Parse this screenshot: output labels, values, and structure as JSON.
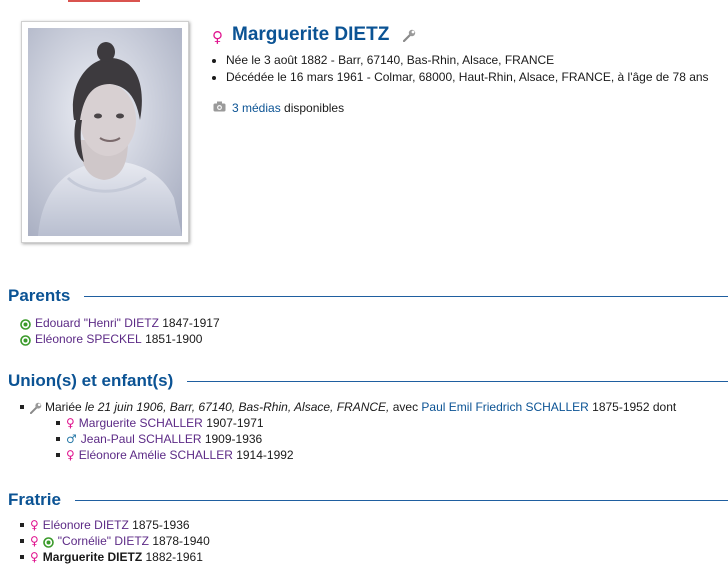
{
  "person": {
    "name": "Marguerite DIETZ",
    "birth": "Née le 3 août 1882 - Barr, 67140, Bas-Rhin, Alsace, FRANCE",
    "death": "Décédée le 16 mars 1961 - Colmar, 68000, Haut-Rhin, Alsace, FRANCE, à l'âge de 78 ans",
    "media_link": "3 médias",
    "media_suffix": " disponibles"
  },
  "parents": {
    "title": "Parents",
    "items": [
      {
        "name": "Edouard \"Henri\" DIETZ",
        "dates": " 1847-1917"
      },
      {
        "name": "Eléonore SPECKEL",
        "dates": " 1851-1900"
      }
    ]
  },
  "unions": {
    "title": "Union(s) et enfant(s)",
    "married_prefix": "Mariée ",
    "married_details": "le 21 juin 1906, Barr, 67140, Bas-Rhin, Alsace, FRANCE,",
    "with_text": " avec ",
    "spouse": "Paul Emil Friedrich SCHALLER",
    "spouse_dates": " 1875-1952 dont",
    "children": [
      {
        "name": "Marguerite SCHALLER",
        "dates": " 1907-1971",
        "sex": "F"
      },
      {
        "name": "Jean-Paul SCHALLER",
        "dates": " 1909-1936",
        "sex": "M"
      },
      {
        "name": "Eléonore Amélie SCHALLER",
        "dates": " 1914-1992",
        "sex": "F"
      }
    ]
  },
  "siblings": {
    "title": "Fratrie",
    "items": [
      {
        "name": "Eléonore DIETZ",
        "dates": " 1875-1936"
      },
      {
        "name": "\"Cornélie\" DIETZ",
        "dates": " 1878-1940"
      },
      {
        "name": "Marguerite DIETZ",
        "dates": " 1882-1961"
      }
    ]
  },
  "symbols": {
    "female": "♀",
    "male": "♂"
  },
  "colors": {
    "link": "#0b5394",
    "visited": "#5c2a86",
    "female": "#e0148f",
    "male": "#2a7aa8",
    "parent_icon": "#3a9a2a"
  }
}
